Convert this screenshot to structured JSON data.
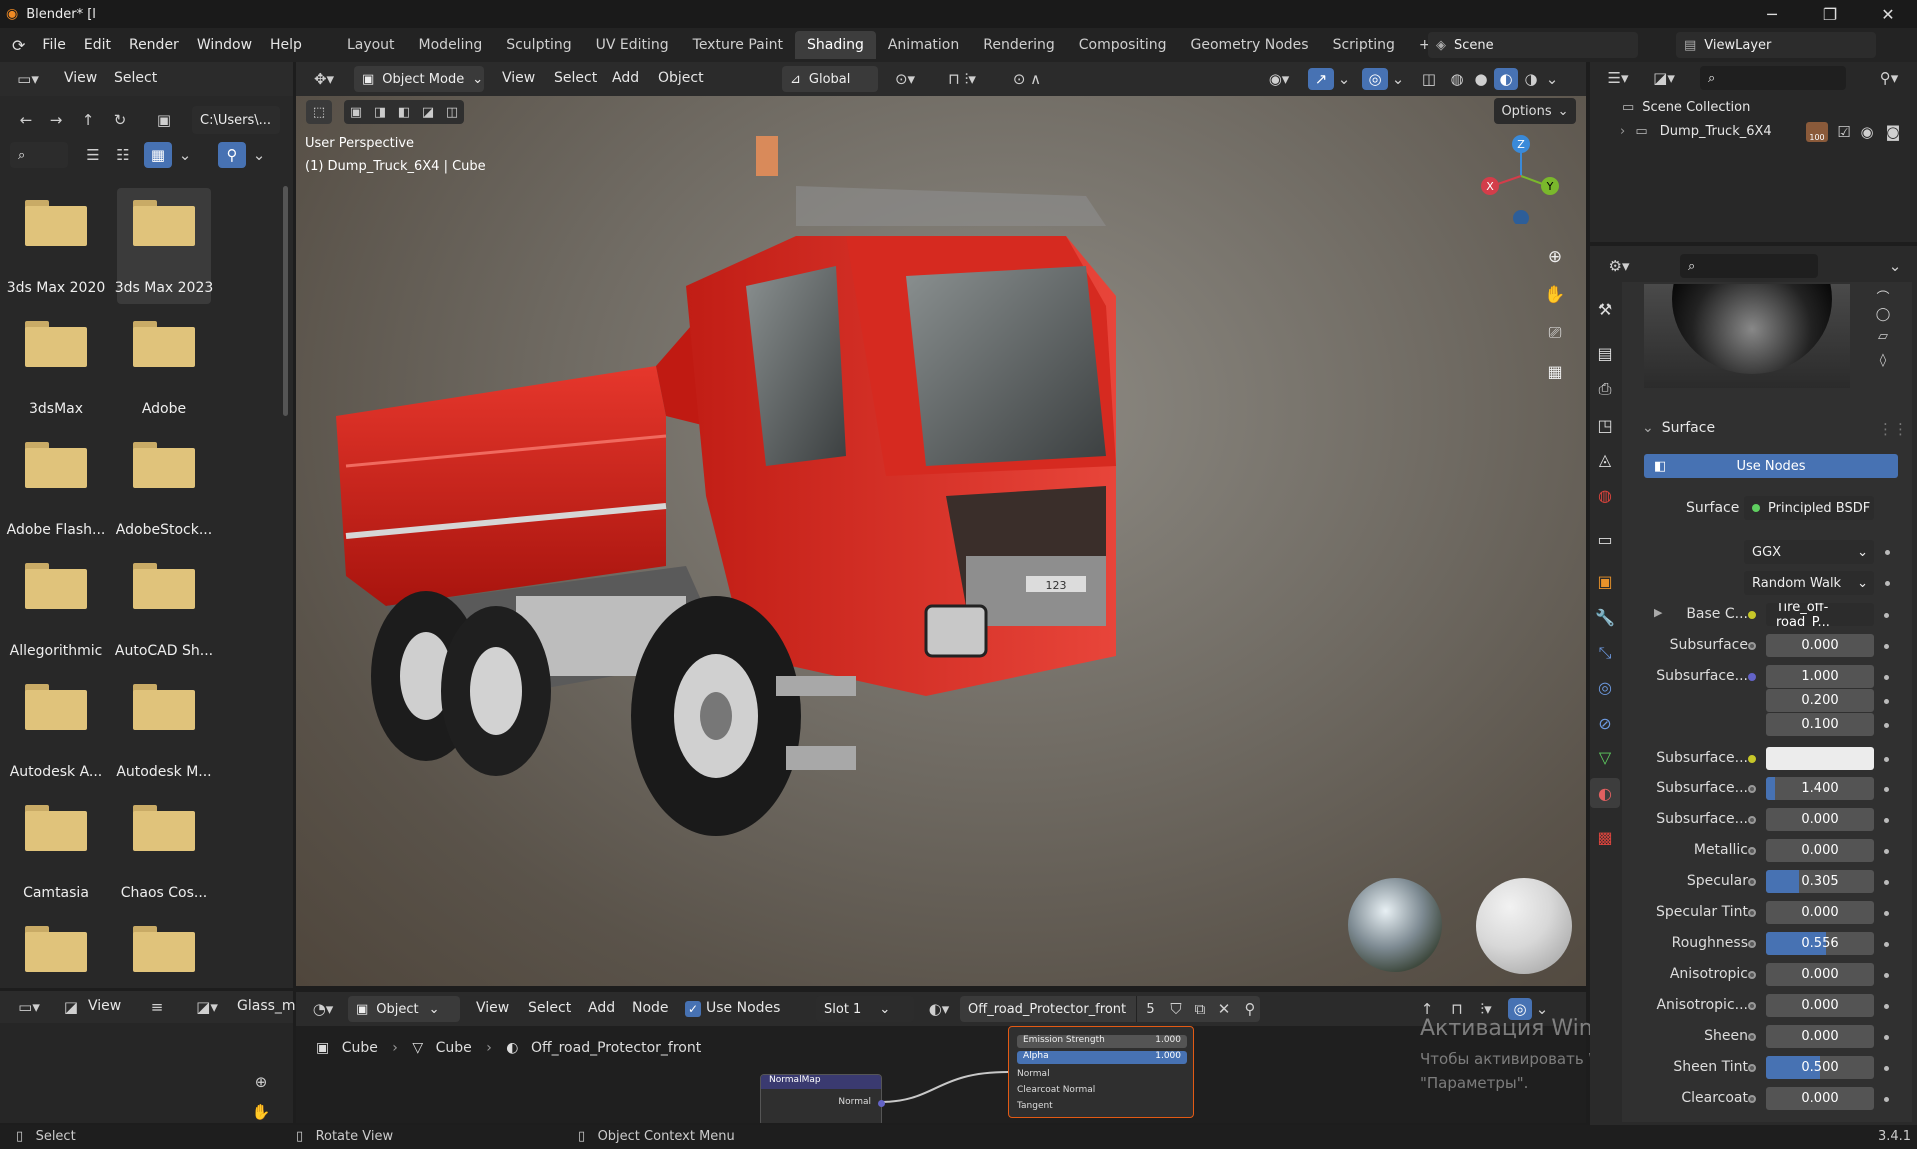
{
  "window": {
    "title": "Blender* [l",
    "minimize": "─",
    "maximize": "❐",
    "close": "✕"
  },
  "menu": [
    "File",
    "Edit",
    "Render",
    "Window",
    "Help"
  ],
  "workspaces": [
    "Layout",
    "Modeling",
    "Sculpting",
    "UV Editing",
    "Texture Paint",
    "Shading",
    "Animation",
    "Rendering",
    "Compositing",
    "Geometry Nodes",
    "Scripting"
  ],
  "active_workspace": "Shading",
  "add_workspace": "+",
  "scene": {
    "name": "Scene",
    "view_layer": "ViewLayer"
  },
  "file_browser": {
    "menu": [
      "View",
      "Select"
    ],
    "path": "C:\\Users\\...",
    "folders": [
      "3ds Max 2020",
      "3ds Max 2023",
      "3dsMax",
      "Adobe",
      "Adobe Flash...",
      "AdobeStock...",
      "Allegorithmic",
      "AutoCAD Sh...",
      "Autodesk A...",
      "Autodesk M...",
      "Camtasia",
      "Chaos Cos...",
      "",
      ""
    ],
    "selected_folder": "3ds Max 2023"
  },
  "viewport": {
    "mode": "Object Mode",
    "menu": [
      "View",
      "Select",
      "Add",
      "Object"
    ],
    "orientation": "Global",
    "options": "Options",
    "info_line1": "User Perspective",
    "info_line2": "(1) Dump_Truck_6X4 | Cube",
    "gizmo": {
      "x": "X",
      "y": "Y",
      "z": "Z"
    },
    "plate_text": "123"
  },
  "outliner": {
    "root": "Scene Collection",
    "item": "Dump_Truck_6X4",
    "badge": "100"
  },
  "properties": {
    "section": "Surface",
    "use_nodes": "Use Nodes",
    "surface_label": "Surface",
    "surface_value": "Principled BSDF",
    "distribution": "GGX",
    "subsurface_method": "Random Walk",
    "rows": [
      {
        "label": "Base C...",
        "value": "Tire_off-road_P...",
        "fill": 0
      },
      {
        "label": "Subsurface",
        "value": "0.000",
        "fill": 0
      },
      {
        "label": "Subsurface...",
        "value": "1.000",
        "fill": 0
      },
      {
        "label": "",
        "value": "0.200",
        "fill": 0
      },
      {
        "label": "",
        "value": "0.100",
        "fill": 0
      },
      {
        "label": "Subsurface...",
        "value": "",
        "fill": 0
      },
      {
        "label": "Subsurface...",
        "value": "1.400",
        "fill": 0.08
      },
      {
        "label": "Subsurface...",
        "value": "0.000",
        "fill": 0
      },
      {
        "label": "Metallic",
        "value": "0.000",
        "fill": 0
      },
      {
        "label": "Specular",
        "value": "0.305",
        "fill": 0.305
      },
      {
        "label": "Specular Tint",
        "value": "0.000",
        "fill": 0
      },
      {
        "label": "Roughness",
        "value": "0.556",
        "fill": 0.556
      },
      {
        "label": "Anisotropic",
        "value": "0.000",
        "fill": 0
      },
      {
        "label": "Anisotropic...",
        "value": "0.000",
        "fill": 0
      },
      {
        "label": "Sheen",
        "value": "0.000",
        "fill": 0
      },
      {
        "label": "Sheen Tint",
        "value": "0.500",
        "fill": 0.5
      },
      {
        "label": "Clearcoat",
        "value": "0.000",
        "fill": 0
      }
    ]
  },
  "node_editor": {
    "object": "Object",
    "menu": [
      "View",
      "Select",
      "Add",
      "Node"
    ],
    "use_nodes": "Use Nodes",
    "slot": "Slot 1",
    "material": "Off_road_Protector_front",
    "users": "5",
    "breadcrumb": [
      "Cube",
      "Cube",
      "Off_road_Protector_front"
    ],
    "node_normalmap": {
      "title": "NormalMap",
      "output": "Normal"
    },
    "node_bsdf": {
      "emission_strength": "Emission Strength",
      "emission_value": "1.000",
      "alpha": "Alpha",
      "alpha_value": "1.000",
      "inputs": [
        "Normal",
        "Clearcoat Normal",
        "Tangent"
      ]
    }
  },
  "image_editor": {
    "view": "View",
    "image": "Glass_m"
  },
  "watermark": {
    "line1": "Активация Windows",
    "line2": "Чтобы активировать Windows, перейдите в раздел",
    "line3": "\"Параметры\"."
  },
  "status": {
    "left": "Select",
    "middle": "Rotate View",
    "right": "Object Context Menu",
    "version": "3.4.1"
  }
}
